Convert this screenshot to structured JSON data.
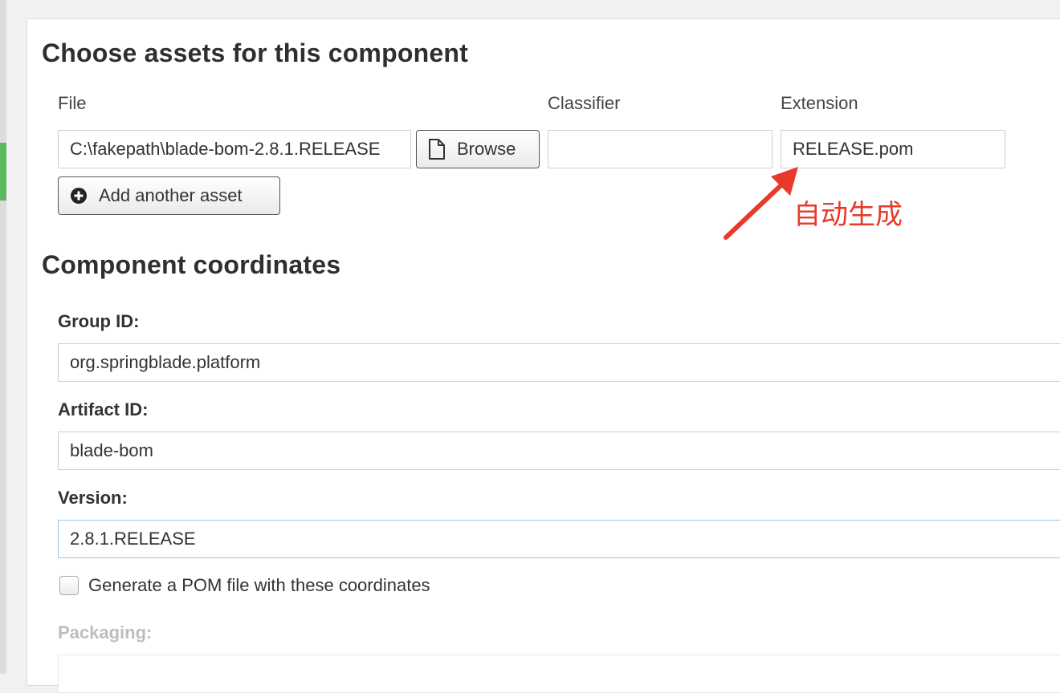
{
  "assets_section": {
    "title": "Choose assets for this component",
    "columns": {
      "file": "File",
      "classifier": "Classifier",
      "extension": "Extension"
    },
    "file_value": "C:\\fakepath\\blade-bom-2.8.1.RELEASE",
    "classifier_value": "",
    "extension_value": "RELEASE.pom",
    "browse_label": "Browse",
    "add_asset_label": "Add another asset"
  },
  "annotation": {
    "text": "自动生成",
    "color": "#e8392b"
  },
  "coordinates_section": {
    "title": "Component coordinates",
    "group_id_label": "Group ID:",
    "group_id_value": "org.springblade.platform",
    "artifact_id_label": "Artifact ID:",
    "artifact_id_value": "blade-bom",
    "version_label": "Version:",
    "version_value": "2.8.1.RELEASE",
    "generate_pom_label": "Generate a POM file with these coordinates",
    "generate_pom_checked": false,
    "packaging_label": "Packaging:",
    "packaging_value": ""
  },
  "icons": {
    "browse": "file-icon",
    "add": "plus-circle-icon"
  },
  "colors": {
    "accent": "#5cb85c",
    "focus_border": "#9ec3e6",
    "disabled_label": "#bdbdbd"
  }
}
